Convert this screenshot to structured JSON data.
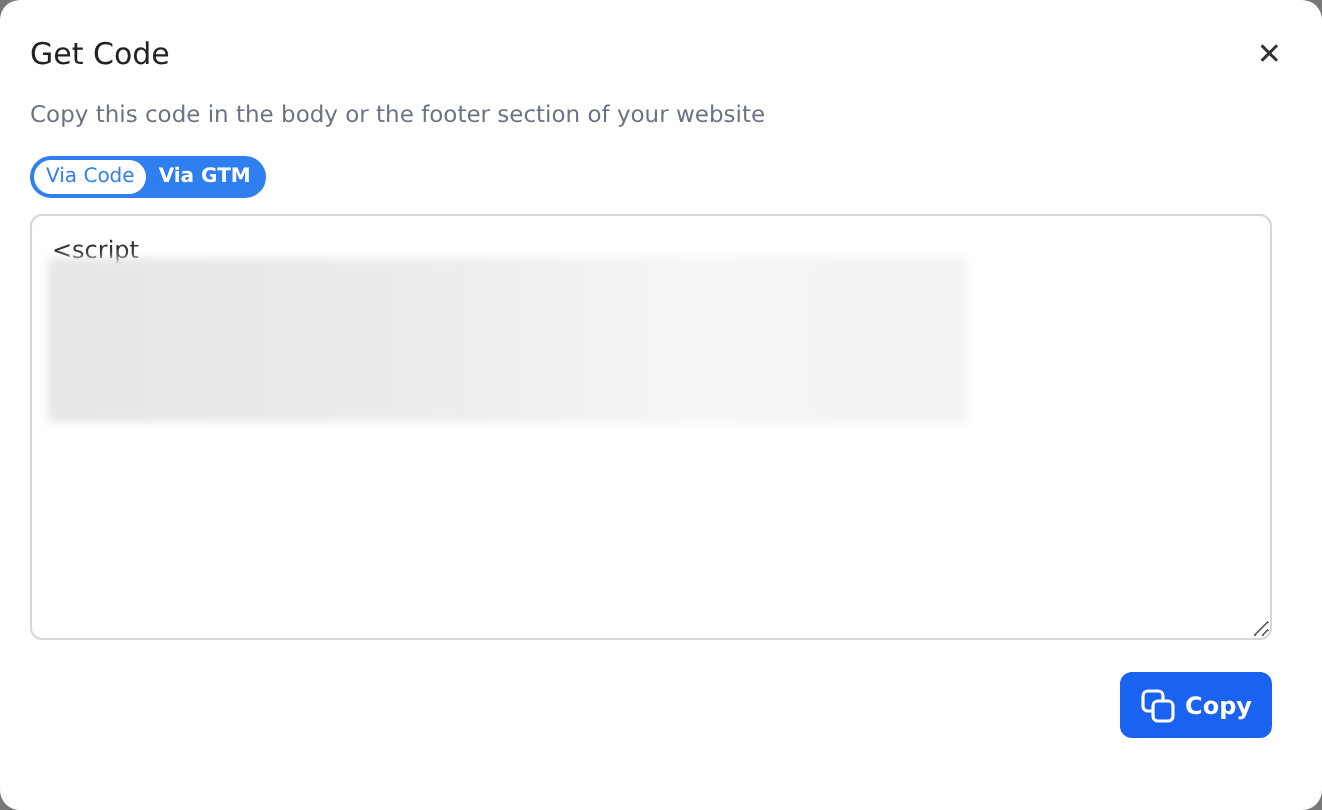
{
  "dialog": {
    "title": "Get Code",
    "close": "✕",
    "description": "Copy this code in the body or the footer section of your website"
  },
  "tabs": [
    {
      "label": "Via Code",
      "selected": true
    },
    {
      "label": "Via GTM",
      "selected": false
    }
  ],
  "code": {
    "value": "<script"
  },
  "buttons": [
    {
      "label": "Copy"
    }
  ]
}
